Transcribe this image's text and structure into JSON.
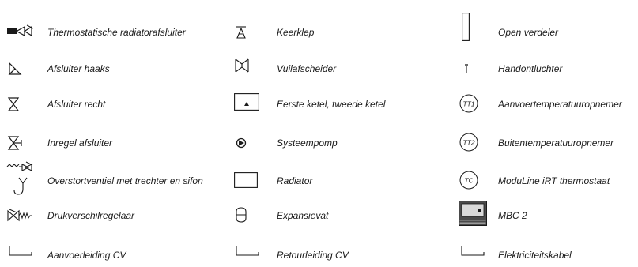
{
  "legend": {
    "columns": [
      [
        {
          "icon": "thermostatic-radiator-valve-icon",
          "label": "Thermostatische radiatorafsluiter"
        },
        {
          "icon": "angle-valve-icon",
          "label": "Afsluiter haaks"
        },
        {
          "icon": "straight-valve-icon",
          "label": "Afsluiter recht"
        },
        {
          "icon": "regulating-valve-icon",
          "label": "Inregel afsluiter"
        },
        {
          "icon": "overflow-valve-funnel-siphon-icon",
          "label": "Overstortventiel met trechter en sifon"
        },
        {
          "icon": "differential-pressure-regulator-icon",
          "label": "Drukverschilregelaar"
        },
        {
          "icon": "pipe-corner-icon",
          "label": "Aanvoerleiding CV"
        }
      ],
      [
        {
          "icon": "check-valve-icon",
          "label": "Keerklep"
        },
        {
          "icon": "dirt-separator-icon",
          "label": "Vuilafscheider"
        },
        {
          "icon": "boiler-icon",
          "label": "Eerste ketel, tweede ketel"
        },
        {
          "icon": "system-pump-icon",
          "label": "Systeempomp"
        },
        {
          "icon": "radiator-icon",
          "label": "Radiator"
        },
        {
          "icon": "expansion-vessel-icon",
          "label": "Expansievat"
        },
        {
          "icon": "pipe-corner-icon",
          "label": "Retourleiding CV"
        }
      ],
      [
        {
          "icon": "open-distributor-icon",
          "label": "Open verdeler"
        },
        {
          "icon": "manual-air-vent-icon",
          "label": "Handontluchter"
        },
        {
          "icon": "supply-temp-sensor-icon",
          "label": "Aanvoertemperatuuropnemer",
          "badge": "TT1"
        },
        {
          "icon": "outdoor-temp-sensor-icon",
          "label": "Buitentemperatuuropnemer",
          "badge": "TT2"
        },
        {
          "icon": "thermostat-icon",
          "label": "ModuLine iRT thermostaat",
          "badge": "TC"
        },
        {
          "icon": "mbc-controller-icon",
          "label": "MBC 2"
        },
        {
          "icon": "pipe-corner-icon",
          "label": "Elektriciteitskabel"
        }
      ]
    ]
  }
}
